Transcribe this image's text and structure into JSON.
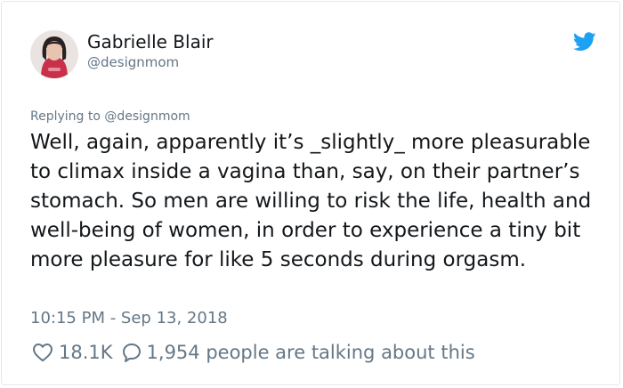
{
  "author": {
    "display_name": "Gabrielle Blair",
    "handle": "@designmom"
  },
  "icons": {
    "brand": "twitter-bird-icon",
    "like": "heart-outline-icon",
    "reply": "speech-bubble-icon"
  },
  "colors": {
    "brand_blue": "#1da1f2",
    "muted_text": "#657786",
    "main_text": "#14171a"
  },
  "tweet": {
    "replying_to": "Replying to @designmom",
    "text": "Well, again, apparently it’s _slightly_ more pleasurable to climax inside a vagina than, say, on their partner’s stomach. So men are willing to risk the life, health and well-being of women, in order to experience a tiny bit more pleasure for like 5 seconds during orgasm.",
    "timestamp": "10:15 PM - Sep 13, 2018"
  },
  "stats": {
    "likes": "18.1K",
    "talking": "1,954 people are talking about this"
  }
}
